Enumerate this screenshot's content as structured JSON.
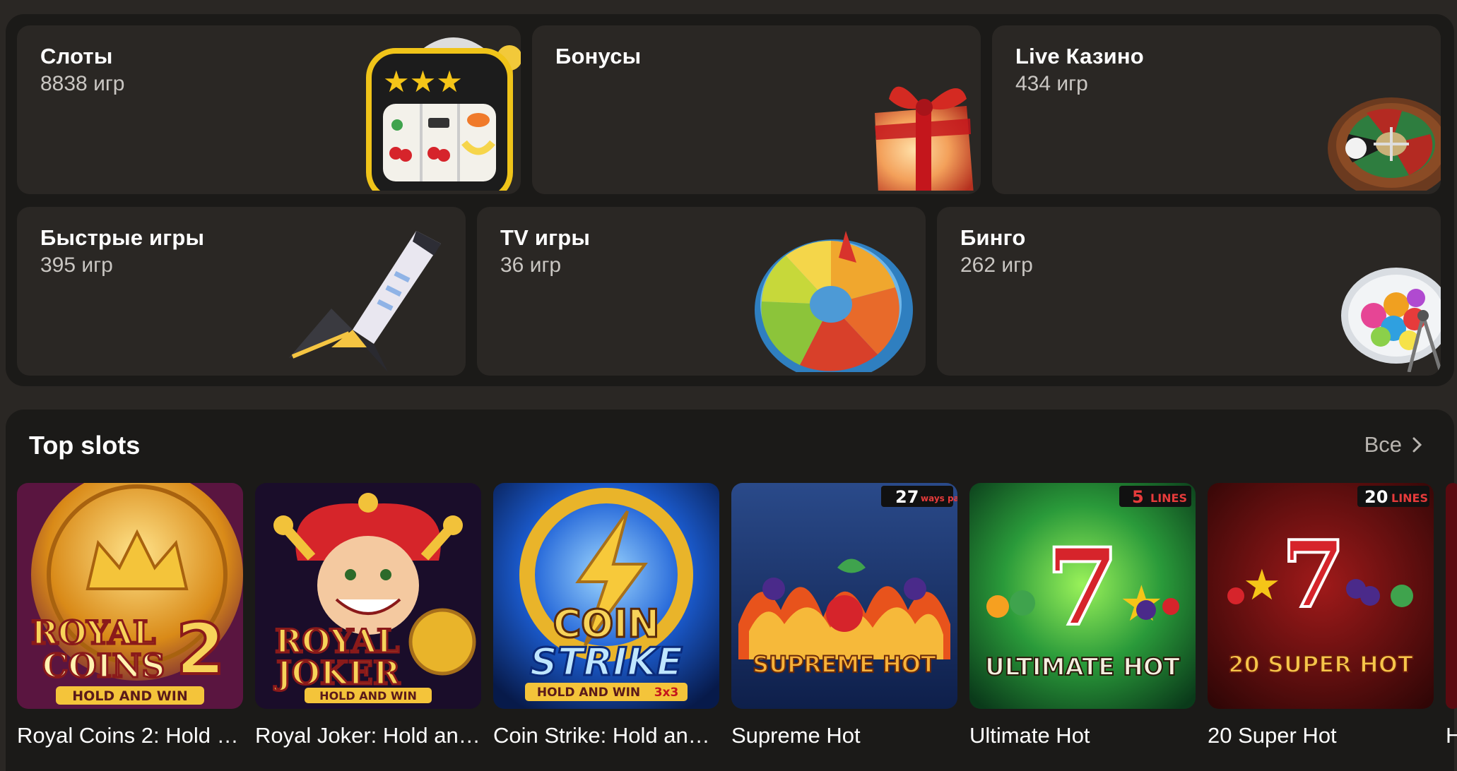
{
  "categories": [
    {
      "title": "Слоты",
      "count": "8838 игр",
      "icon": "slot-machine-icon"
    },
    {
      "title": "Бонусы",
      "count": "",
      "icon": "gift-box-icon"
    },
    {
      "title": "Live Казино",
      "count": "434 игр",
      "icon": "roulette-wheel-icon"
    },
    {
      "title": "Быстрые игры",
      "count": "395 игр",
      "icon": "rocket-icon"
    },
    {
      "title": "TV игры",
      "count": "36 игр",
      "icon": "wheel-of-fortune-icon"
    },
    {
      "title": "Бинго",
      "count": "262 игр",
      "icon": "bingo-drum-icon"
    }
  ],
  "top_slots": {
    "title": "Top slots",
    "see_all": "Все",
    "games": [
      {
        "name": "Royal Coins 2: Hold …",
        "art_line1": "ROYAL",
        "art_line2": "COINS",
        "art_num": "2",
        "art_sub": "HOLD AND WIN"
      },
      {
        "name": "Royal Joker: Hold an…",
        "art_line1": "ROYAL",
        "art_line2": "JOKER",
        "art_sub": "HOLD AND WIN"
      },
      {
        "name": "Coin Strike: Hold an…",
        "art_line1": "COIN",
        "art_line2": "STRIKE",
        "art_sub": "HOLD AND WIN",
        "art_badge": "3x3"
      },
      {
        "name": "Supreme Hot",
        "art_line1": "SUPREME HOT",
        "art_badge_num": "27",
        "art_badge_text": "ways pay"
      },
      {
        "name": "Ultimate Hot",
        "art_line1": "ULTIMATE HOT",
        "art_badge_num": "5",
        "art_badge_text": "LINES"
      },
      {
        "name": "20 Super Hot",
        "art_line1": "20 SUPER HOT",
        "art_badge_num": "20",
        "art_badge_text": "LINES"
      },
      {
        "name": "H"
      }
    ]
  },
  "colors": {
    "page_bg": "#2a2724",
    "panel_bg": "#1b1a18",
    "card_bg": "#2a2724",
    "muted_text": "#c9c6c2"
  }
}
